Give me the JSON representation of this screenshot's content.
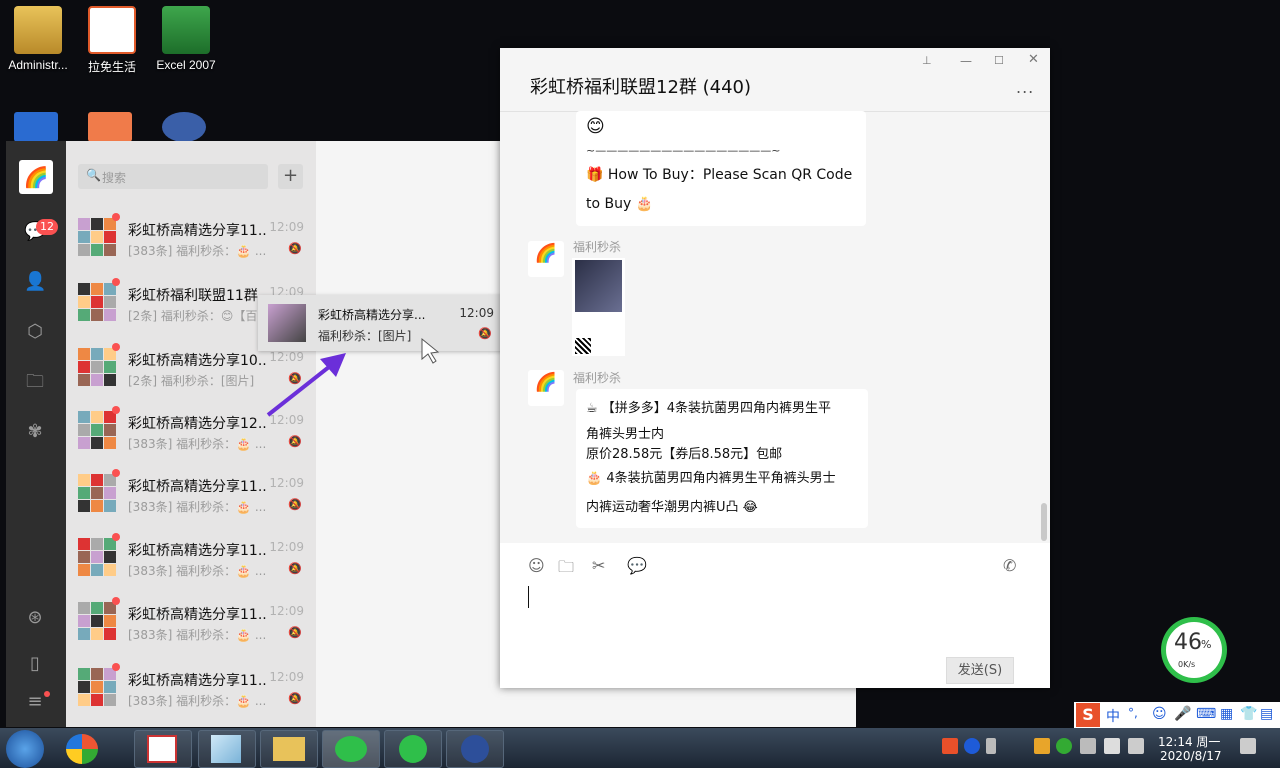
{
  "desktop": {
    "icons": [
      {
        "label": "Administr..."
      },
      {
        "label": "拉免生活"
      },
      {
        "label": "Excel 2007"
      }
    ]
  },
  "main_window": {
    "sidebar": {
      "unread_badge": "12"
    },
    "search": {
      "placeholder": "搜索",
      "add_symbol": "+"
    },
    "chats": [
      {
        "name": "彩虹桥高精选分享11...",
        "time": "12:09",
        "preview": "[383条] 福利秒杀：🎂 ..."
      },
      {
        "name": "彩虹桥福利联盟11群",
        "time": "12:09",
        "preview": "[2条] 福利秒杀：😊【百..."
      },
      {
        "name": "彩虹桥高精选分享10...",
        "time": "12:09",
        "preview": "[2条] 福利秒杀：[图片]"
      },
      {
        "name": "彩虹桥高精选分享12...",
        "time": "12:09",
        "preview": "[383条] 福利秒杀：🎂 ..."
      },
      {
        "name": "彩虹桥高精选分享11...",
        "time": "12:09",
        "preview": "[383条] 福利秒杀：🎂 ..."
      },
      {
        "name": "彩虹桥高精选分享11...",
        "time": "12:09",
        "preview": "[383条] 福利秒杀：🎂 ..."
      },
      {
        "name": "彩虹桥高精选分享11...",
        "time": "12:09",
        "preview": "[383条] 福利秒杀：🎂 ..."
      },
      {
        "name": "彩虹桥高精选分享11...",
        "time": "12:09",
        "preview": "[383条] 福利秒杀：🎂 ..."
      }
    ],
    "drag_preview": {
      "name": "彩虹桥高精选分享...",
      "time": "12:09",
      "preview": "福利秒杀：[图片]"
    }
  },
  "chat_window": {
    "title": "彩虹桥福利联盟12群 (440)",
    "more": "...",
    "messages": [
      {
        "smiley": "😊",
        "divider": "~————————————————~",
        "line1": "🎁 How To Buy：Please Scan QR Code",
        "line2": "to Buy 🎂"
      },
      {
        "sender": "福利秒杀",
        "avatar_text": "彩虹桥"
      },
      {
        "sender": "福利秒杀",
        "avatar_text": "彩虹桥",
        "line1": "☕ 【拼多多】4条装抗菌男四角内裤男生平",
        "line2": "角裤头男士内",
        "line3": "原价28.58元【券后8.58元】包邮",
        "line4": "🎂 4条装抗菌男四角内裤男生平角裤头男士",
        "line5": "内裤运动奢华潮男内裤U凸 😂"
      }
    ],
    "send_button": "发送(S)"
  },
  "net_widget": {
    "percent": "46",
    "percent_sign": "%",
    "speed": "0K/s"
  },
  "taskbar": {
    "clock_time": "12:14 周一",
    "clock_date": "2020/8/17",
    "ime_lang": "中",
    "ime_punct": "°,"
  },
  "colors": {
    "badge": "#fa5151",
    "accent_green": "#2fbf4a",
    "wx_sidebar": "#2e2e2e"
  }
}
